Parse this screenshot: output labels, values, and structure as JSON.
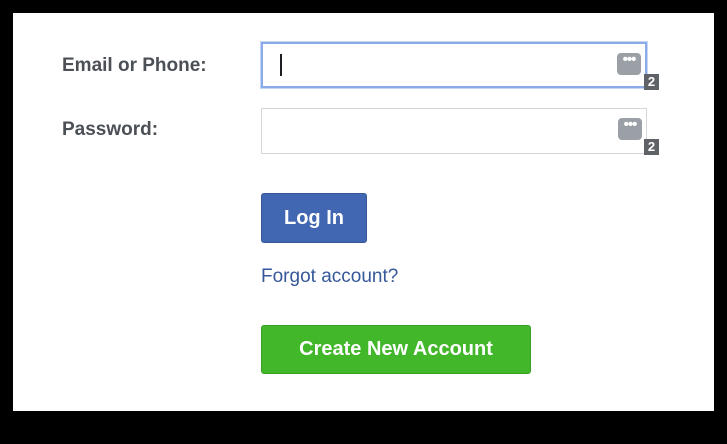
{
  "login_form": {
    "email_label": "Email or Phone:",
    "email_value": "",
    "password_label": "Password:",
    "password_value": "",
    "password_manager_icon": "ellipsis-icon",
    "password_manager_glyph": "•••",
    "saved_credentials_count": "2",
    "login_button_label": "Log In",
    "forgot_link_label": "Forgot account?",
    "create_account_label": "Create New Account"
  },
  "colors": {
    "login_button": "#4267b2",
    "create_button": "#42b72a",
    "link": "#365899",
    "label": "#4b4f56",
    "focus_border": "#8aabe8"
  }
}
